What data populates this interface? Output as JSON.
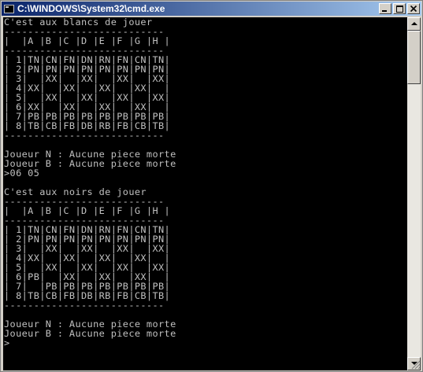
{
  "window": {
    "title": "C:\\WINDOWS\\System32\\cmd.exe",
    "icon": "console-icon",
    "buttons": [
      "minimize-icon",
      "maximize-icon",
      "close-icon"
    ]
  },
  "console": {
    "lines": [
      "C'est aux blancs de jouer",
      "---------------------------",
      "|  |A |B |C |D |E |F |G |H |",
      "---------------------------",
      "| 1|TN|CN|FN|DN|RN|FN|CN|TN|",
      "| 2|PN|PN|PN|PN|PN|PN|PN|PN|",
      "| 3|  |XX|  |XX|  |XX|  |XX|",
      "| 4|XX|  |XX|  |XX|  |XX|  |",
      "| 5|  |XX|  |XX|  |XX|  |XX|",
      "| 6|XX|  |XX|  |XX|  |XX|  |",
      "| 7|PB|PB|PB|PB|PB|PB|PB|PB|",
      "| 8|TB|CB|FB|DB|RB|FB|CB|TB|",
      "---------------------------",
      "",
      "Joueur N : Aucune piece morte",
      "Joueur B : Aucune piece morte",
      ">06 05",
      "",
      "C'est aux noirs de jouer",
      "---------------------------",
      "|  |A |B |C |D |E |F |G |H |",
      "---------------------------",
      "| 1|TN|CN|FN|DN|RN|FN|CN|TN|",
      "| 2|PN|PN|PN|PN|PN|PN|PN|PN|",
      "| 3|  |XX|  |XX|  |XX|  |XX|",
      "| 4|XX|  |XX|  |XX|  |XX|  |",
      "| 5|  |XX|  |XX|  |XX|  |XX|",
      "| 6|PB|  |XX|  |XX|  |XX|  |",
      "| 7|  |PB|PB|PB|PB|PB|PB|PB|",
      "| 8|TB|CB|FB|DB|RB|FB|CB|TB|",
      "---------------------------",
      "",
      "Joueur N : Aucune piece morte",
      "Joueur B : Aucune piece morte",
      ">"
    ]
  }
}
